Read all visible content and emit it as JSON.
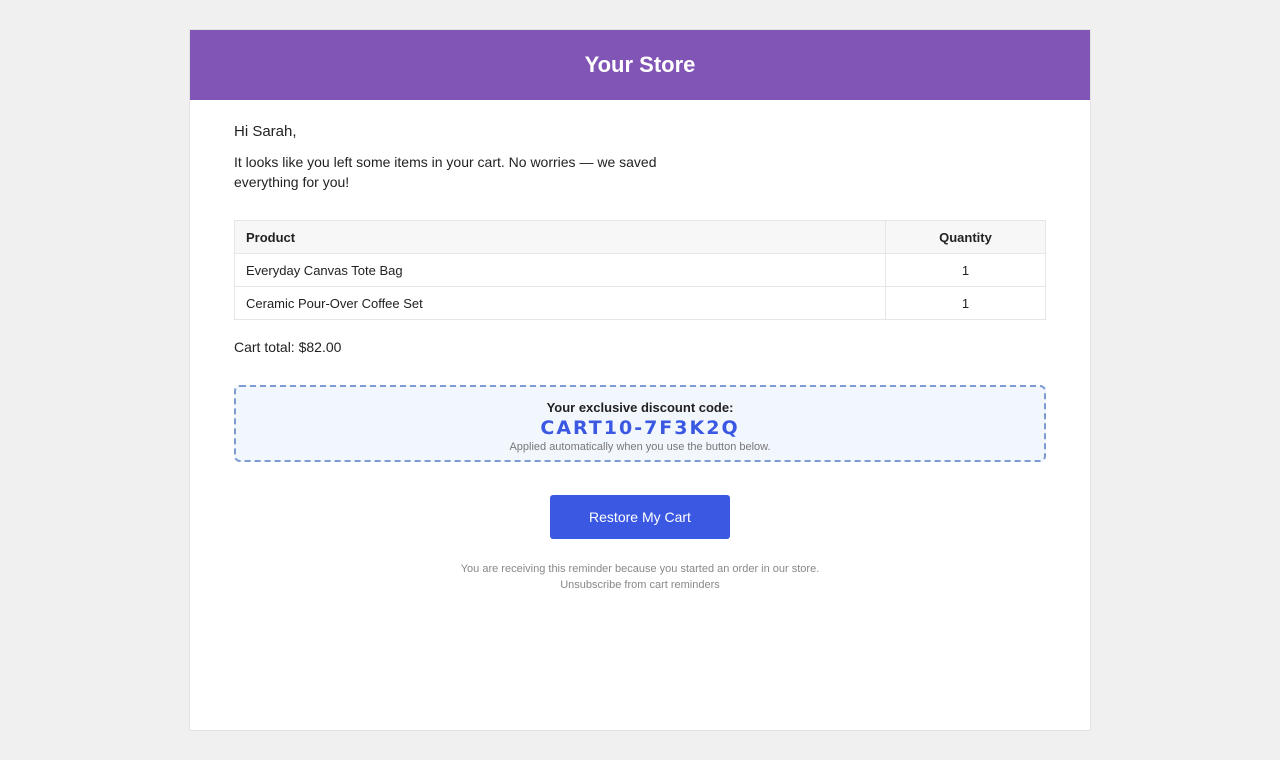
{
  "header": {
    "store_name": "Your Store"
  },
  "email": {
    "greeting": "Hi Sarah,",
    "intro": "It looks like you left some items in your cart. No worries — we saved everything for you!"
  },
  "cart": {
    "columns": [
      "Product",
      "Quantity"
    ],
    "rows": [
      {
        "product": "Everyday Canvas Tote Bag",
        "quantity": "1"
      },
      {
        "product": "Ceramic Pour-Over Coffee Set",
        "quantity": "1"
      }
    ],
    "total_text": "Cart total: $82.00"
  },
  "discount": {
    "label": "Your exclusive discount code:",
    "code": "CART10-7F3K2Q",
    "note": "Applied automatically when you use the button below."
  },
  "cta": {
    "label": "Restore My Cart"
  },
  "footer": {
    "reason": "You are receiving this reminder because you started an order in our store.",
    "unsubscribe_label": "Unsubscribe from cart reminders"
  },
  "colors": {
    "header_bg": "#8155b5",
    "accent": "#3a58e2",
    "discount_border": "#7b9bd1",
    "discount_bg": "#f2f7fd",
    "page_bg": "#f0f0f0"
  }
}
